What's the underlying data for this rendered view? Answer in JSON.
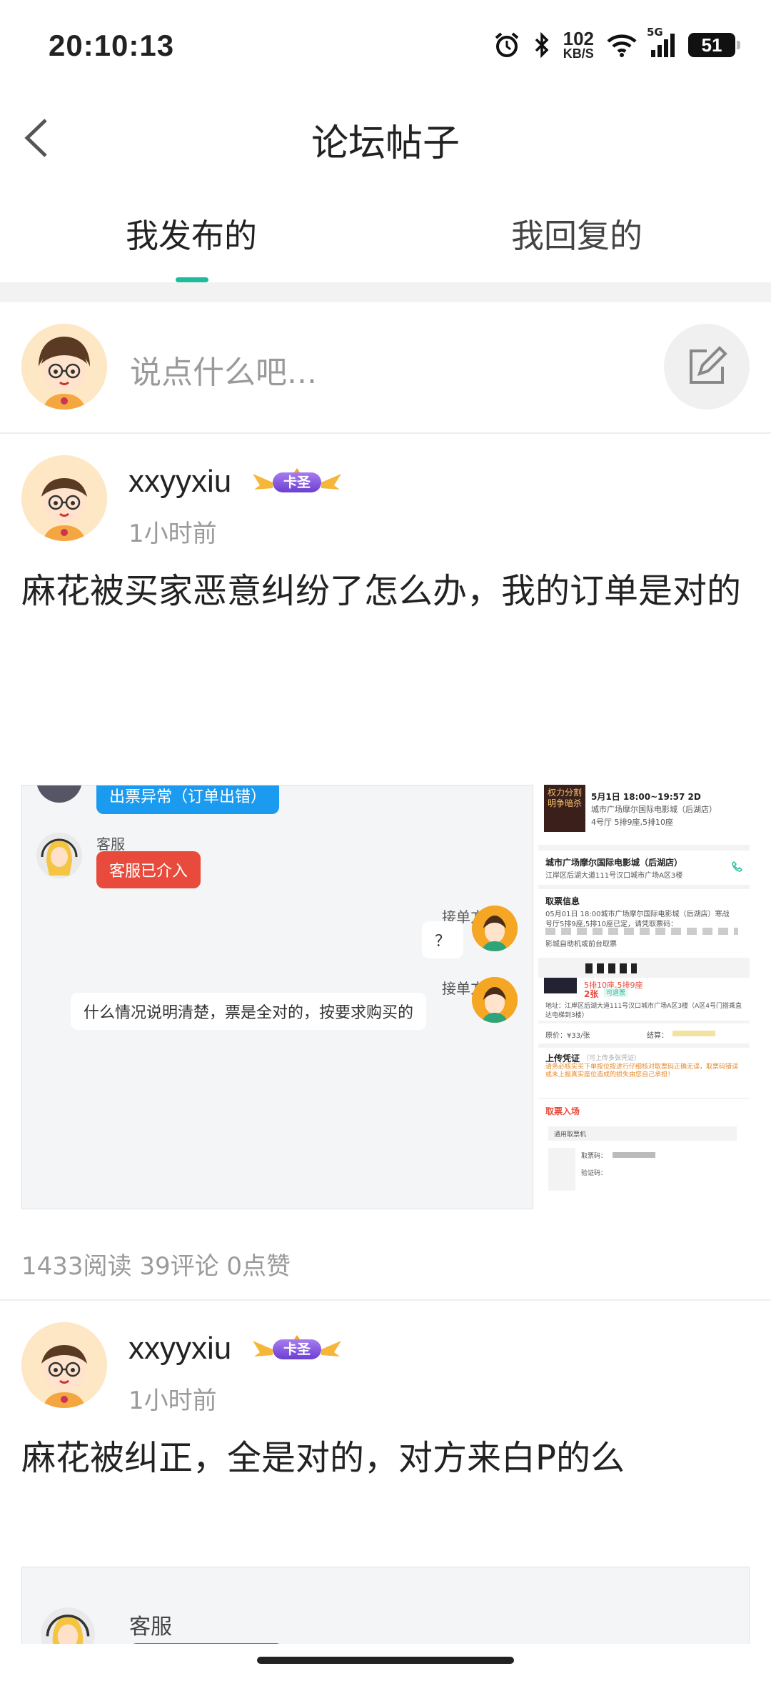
{
  "status_bar": {
    "time": "20:10:13",
    "net_speed": "102",
    "net_unit": "KB/S",
    "signal_label": "5G",
    "battery": "51"
  },
  "header": {
    "title": "论坛帖子"
  },
  "tabs": [
    {
      "label": "我发布的",
      "active": true
    },
    {
      "label": "我回复的",
      "active": false
    }
  ],
  "compose": {
    "placeholder": "说点什么吧..."
  },
  "posts": [
    {
      "username": "xxyyxiu",
      "badge": "卡圣",
      "time_ago": "1小时前",
      "text": "麻花被买家恶意纠纷了怎么办，我的订单是对的",
      "stats": "1433阅读 39评论 0点赞",
      "image": {
        "chat": {
          "top_bubble": "出票异常（订单出错）",
          "agent_name": "客服",
          "agent_bubble": "客服已介入",
          "receiver_name_1": "接单方",
          "receiver_bubble_1": "？",
          "receiver_name_2": "接单方",
          "receiver_bubble_2": "什么情况说明清楚，票是全对的，按要求购买的"
        },
        "order": {
          "poster_text": "权力分割 明争暗杀",
          "show_time": "5月1日 18:00~19:57 2D",
          "cinema": "城市广场摩尔国际电影城（后湖店）",
          "hall": "4号厅 5排9座,5排10座",
          "cinema_name": "城市广场摩尔国际电影城（后湖店）",
          "address": "江岸区后湖大道111号汉口城市广场A区3楼",
          "ticket_info_title": "取票信息",
          "ticket_info_1": "05月01日 18:00城市广场摩尔国际电影城（后湖店）寒战",
          "ticket_info_2": "号厅5排9座,5排10座已定，请凭取票码：",
          "ticket_info_3": "影城自助机或前台取票",
          "tickets_label": "5排10座,5排9座",
          "count": "2张",
          "tag": "可退票",
          "addr_line": "地址：江岸区后湖大道111号汉口城市广场A区3楼（A区4号门搭乘直达电梯到3楼）",
          "price": "原价：¥33/张",
          "settle": "结算：",
          "upload_title": "上传凭证",
          "upload_hint": "（可上传多张凭证）",
          "upload_warn": "请务必核实买下单按位按进行仔细核对取票码正确无误，取票码错误或未上报真实座位造成的损失由您自己承担！",
          "entry_title": "取票入场",
          "entry_machine": "通用取票机",
          "code_label": "取票码：",
          "verify_label": "验证码："
        }
      }
    },
    {
      "username": "xxyyxiu",
      "badge": "卡圣",
      "time_ago": "1小时前",
      "text": "麻花被纠正，全是对的，对方来白P的么",
      "image": {
        "agent_name": "客服"
      }
    }
  ]
}
